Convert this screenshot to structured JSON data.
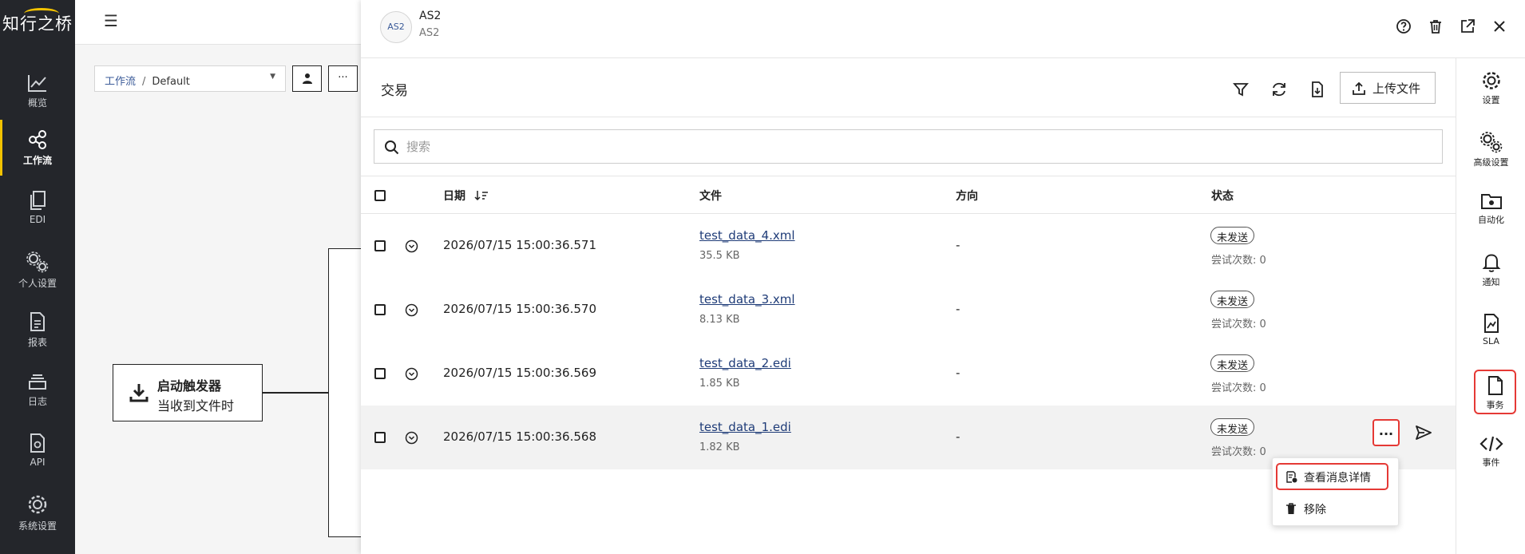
{
  "brand": {
    "logo_text": "知行之桥"
  },
  "left_nav": [
    {
      "label": "概览",
      "icon": "chart-line-icon"
    },
    {
      "label": "工作流",
      "icon": "share-nodes-icon",
      "active": true
    },
    {
      "label": "EDI",
      "icon": "documents-icon"
    },
    {
      "label": "个人设置",
      "icon": "gears-icon"
    },
    {
      "label": "报表",
      "icon": "report-icon"
    },
    {
      "label": "日志",
      "icon": "stack-icon"
    },
    {
      "label": "API",
      "icon": "api-file-icon"
    },
    {
      "label": "系统设置",
      "icon": "gear-icon"
    }
  ],
  "workflow": {
    "breadcrumb_root": "工作流",
    "breadcrumb_sep": "/",
    "breadcrumb_current": "Default",
    "more_label": "···",
    "trigger_title": "启动触发器",
    "trigger_subtitle": "当收到文件时"
  },
  "drawer": {
    "app_icon_text": "AS2",
    "title": "AS2",
    "subtitle": "AS2",
    "section_title": "交易",
    "upload_label": "上传文件",
    "search_placeholder": "搜索",
    "columns": {
      "date": "日期",
      "file": "文件",
      "direction": "方向",
      "status": "状态"
    },
    "rows": [
      {
        "date": "2026/07/15 15:00:36.571",
        "file": "test_data_4.xml",
        "size": "35.5 KB",
        "direction": "-",
        "status": "未发送",
        "tries": "尝试次数: 0"
      },
      {
        "date": "2026/07/15 15:00:36.570",
        "file": "test_data_3.xml",
        "size": "8.13 KB",
        "direction": "-",
        "status": "未发送",
        "tries": "尝试次数: 0"
      },
      {
        "date": "2026/07/15 15:00:36.569",
        "file": "test_data_2.edi",
        "size": "1.85 KB",
        "direction": "-",
        "status": "未发送",
        "tries": "尝试次数: 0"
      },
      {
        "date": "2026/07/15 15:00:36.568",
        "file": "test_data_1.edi",
        "size": "1.82 KB",
        "direction": "-",
        "status": "未发送",
        "tries": "尝试次数: 0"
      }
    ],
    "row_more_label": "...",
    "context_menu": [
      {
        "label": "查看消息详情",
        "icon": "message-details-icon"
      },
      {
        "label": "移除",
        "icon": "trash-icon"
      }
    ]
  },
  "right_rail": [
    {
      "label": "设置",
      "icon": "gear-icon"
    },
    {
      "label": "高级设置",
      "icon": "gears-icon"
    },
    {
      "label": "自动化",
      "icon": "folder-gear-icon"
    },
    {
      "label": "通知",
      "icon": "bell-icon"
    },
    {
      "label": "SLA",
      "icon": "sla-file-icon"
    },
    {
      "label": "事务",
      "icon": "file-icon",
      "active": true
    },
    {
      "label": "事件",
      "icon": "code-icon"
    }
  ],
  "colors": {
    "nav_bg": "#24262b",
    "accent": "#f2c200",
    "highlight": "#e53935",
    "link": "#1f3c78"
  }
}
